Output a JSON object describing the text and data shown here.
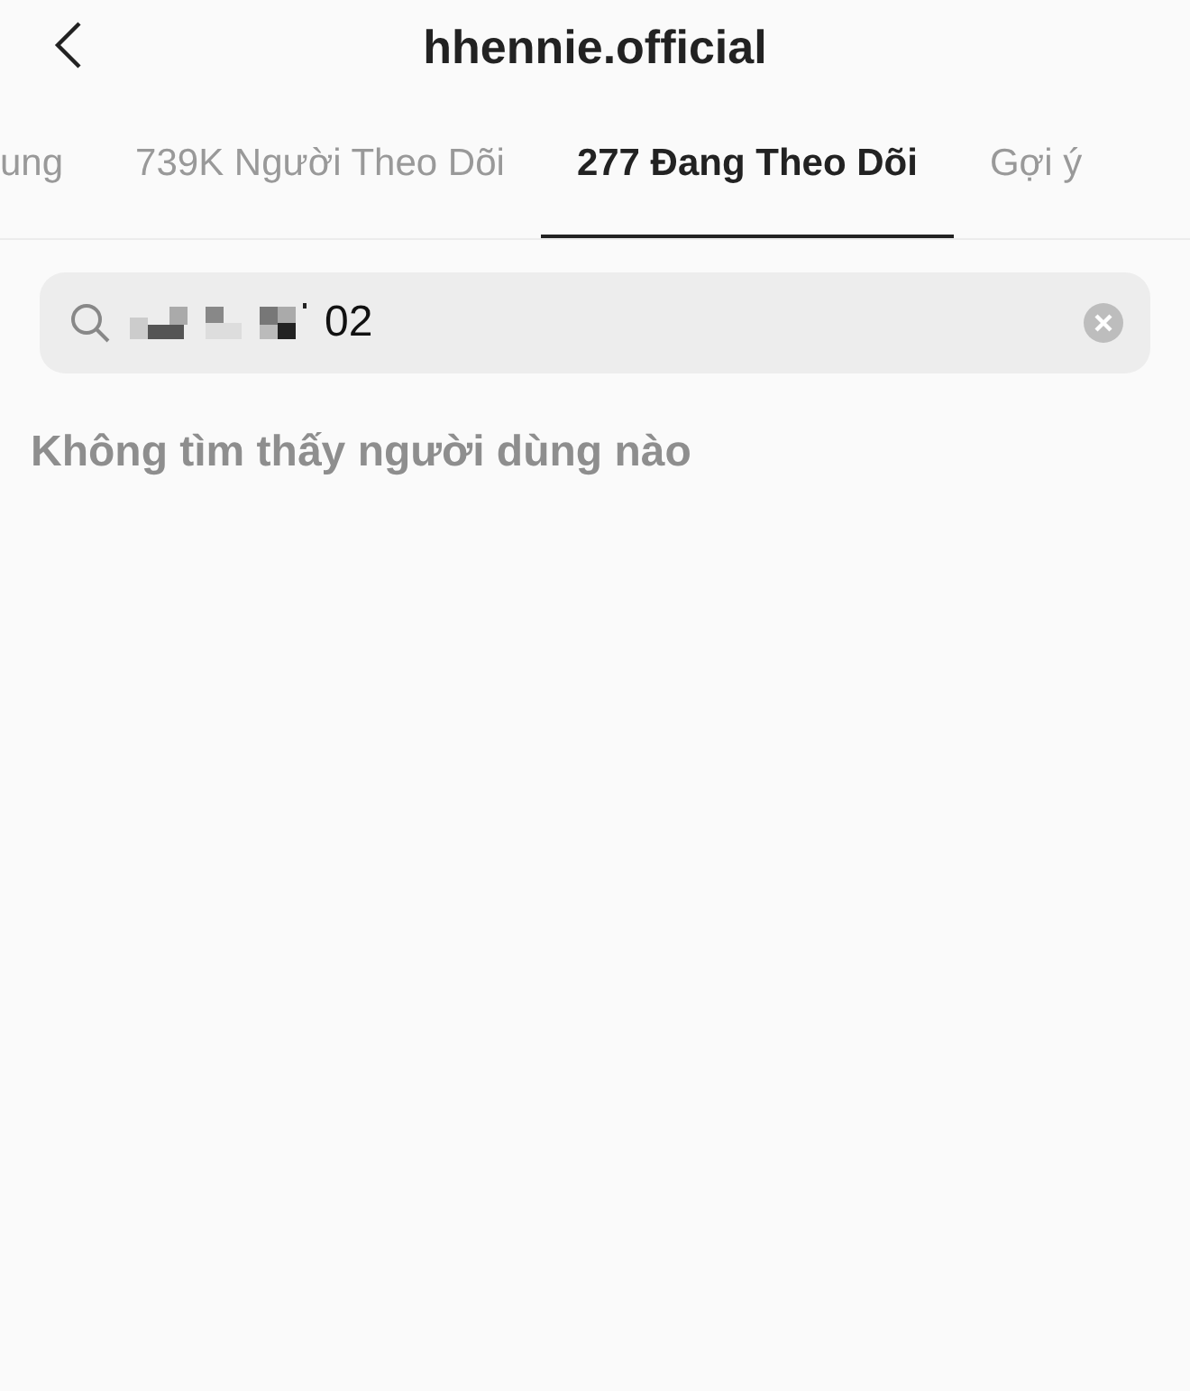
{
  "header": {
    "title": "hhennie.official"
  },
  "tabs": [
    {
      "label": "ung",
      "selected": false
    },
    {
      "label": "739K Người Theo Dõi",
      "selected": false
    },
    {
      "label": "277 Đang Theo Dõi",
      "selected": true
    },
    {
      "label": "Gợi ý",
      "selected": false
    }
  ],
  "search": {
    "value": "02"
  },
  "message": "Không tìm thấy người dùng nào"
}
